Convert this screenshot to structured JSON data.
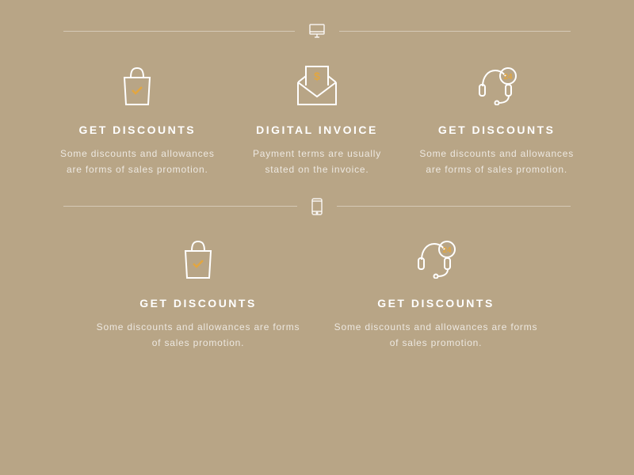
{
  "section1": {
    "features": [
      {
        "title": "GET DISCOUNTS",
        "desc": "Some discounts and allowances are forms of sales promotion."
      },
      {
        "title": "DIGITAL INVOICE",
        "desc": "Payment terms are usually stated on the invoice."
      },
      {
        "title": "GET DISCOUNTS",
        "desc": "Some discounts and allowances are forms of sales promotion."
      }
    ]
  },
  "section2": {
    "features": [
      {
        "title": "GET DISCOUNTS",
        "desc": "Some discounts and allowances are forms of sales promotion."
      },
      {
        "title": "GET DISCOUNTS",
        "desc": "Some discounts and allowances are forms of sales promotion."
      }
    ]
  },
  "badge_text": "24"
}
